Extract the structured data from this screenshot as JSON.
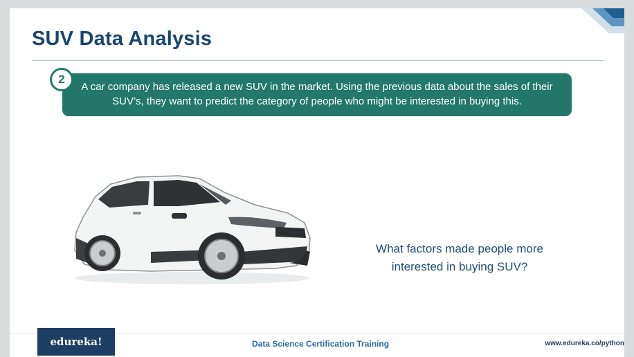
{
  "slide": {
    "title": "SUV Data Analysis",
    "step_number": "2",
    "banner_line1": "A car company has released a new SUV in the market. Using the previous data about the sales of their",
    "banner_line2": "SUV’s, they want to predict the category of people who might be interested in buying this.",
    "question_line1": "What factors made people more",
    "question_line2": "interested in buying SUV?",
    "image": "white-suv-car"
  },
  "footer": {
    "logo": "edureka!",
    "course": "Data Science Certification Training",
    "url": "www.edureka.co/python"
  },
  "colors": {
    "title": "#17456e",
    "banner": "#23786a",
    "question": "#1f4e79",
    "logo_bg": "#1c3f63"
  }
}
